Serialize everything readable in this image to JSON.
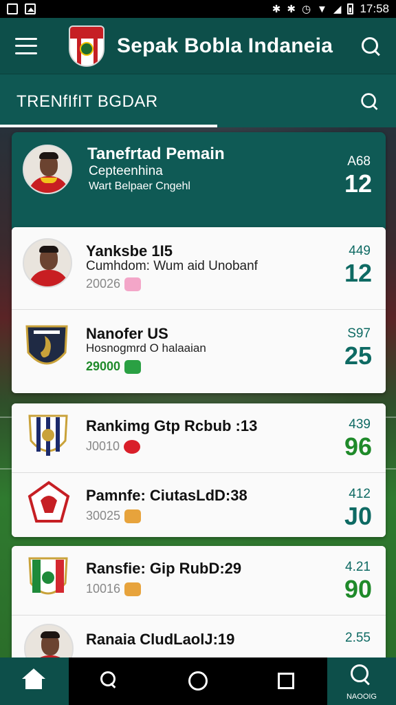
{
  "status_bar": {
    "time": "17:58"
  },
  "app_bar": {
    "title": "Sepak Bobla Indaneia"
  },
  "tab_bar": {
    "active_tab": "TRENfIfIT BGDAR"
  },
  "featured": {
    "title": "Tanefrtad Pemain",
    "subtitle": "Cepteenhina",
    "detail": "Wart Belpaer Cngehl",
    "stat_small": "A68",
    "stat_big": "12"
  },
  "list": [
    {
      "title": "Yanksbe 1I5",
      "subtitle": "Cumhdom: Wum aid Unobanf",
      "meta": "20026",
      "stat_small": "449",
      "stat_big": "12",
      "icon": "flower-badge-icon",
      "meta_green": false
    },
    {
      "title": "Nanofer US",
      "subtitle": "Hosnogmrd O halaaian",
      "meta": "29000",
      "stat_small": "S97",
      "stat_big": "25",
      "icon": "green-ticket-icon",
      "meta_green": true
    },
    {
      "title": "Rankimg Gtp Rcbub :13",
      "subtitle": "",
      "meta": "J0010",
      "stat_small": "439",
      "stat_big": "96",
      "icon": "heart-badge-icon",
      "meta_green": false
    },
    {
      "title": "Pamnfe: CiutasLdD:38",
      "subtitle": "",
      "meta": "30025",
      "stat_small": "412",
      "stat_big": "J0",
      "icon": "star-badge-icon",
      "meta_green": false
    },
    {
      "title": "Ransfie: Gip RubD:29",
      "subtitle": "",
      "meta": "10016",
      "stat_small": "4.21",
      "stat_big": "90",
      "icon": "star-badge-icon",
      "meta_green": false
    },
    {
      "title": "Ranaia CludLaolJ:19",
      "subtitle": "",
      "meta": "",
      "stat_small": "2.55",
      "stat_big": "",
      "icon": "",
      "meta_green": false
    }
  ],
  "bottom_nav": {
    "right_label": "NAOOIG"
  }
}
